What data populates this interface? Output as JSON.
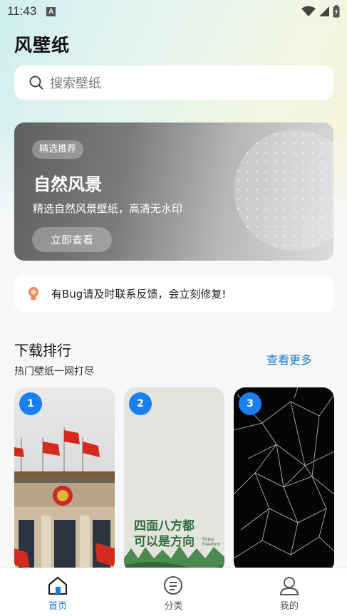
{
  "status_bar": {
    "time": "11:43",
    "notification_icon": "A"
  },
  "app": {
    "title": "风壁纸"
  },
  "search": {
    "placeholder": "搜索壁纸"
  },
  "banner": {
    "tag": "精选推荐",
    "title": "自然风景",
    "description": "精选自然风景壁纸，高清无水印",
    "button": "立即查看"
  },
  "notice": {
    "text": "有Bug请及时联系反馈，会立刻修复!"
  },
  "ranking": {
    "title": "下载排行",
    "subtitle": "热门壁纸一网打尽",
    "more": "查看更多",
    "cards": [
      {
        "rank": "1"
      },
      {
        "rank": "2",
        "poster_text": "四面八方都可以是方向",
        "poster_small": "Enjoy freedom"
      },
      {
        "rank": "3"
      }
    ]
  },
  "tabbar": {
    "items": [
      {
        "label": "首页",
        "icon": "home-icon",
        "active": true
      },
      {
        "label": "分类",
        "icon": "category-icon",
        "active": false
      },
      {
        "label": "我的",
        "icon": "user-icon",
        "active": false
      }
    ]
  },
  "colors": {
    "accent": "#1c7bd6",
    "rank_badge": "#1a7ff0"
  }
}
